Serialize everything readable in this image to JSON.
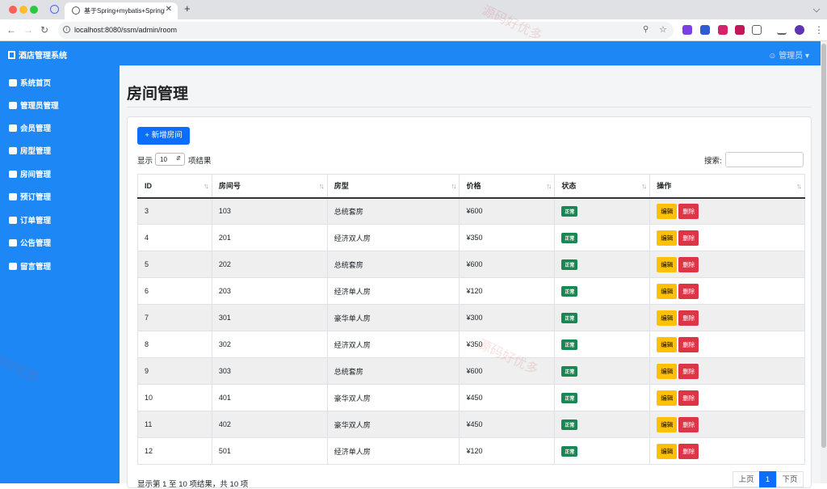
{
  "browser": {
    "tab_title": "基于Spring+mybatis+SpringM",
    "tab_close": "✕",
    "new_tab": "+",
    "url": "localhost:8080/ssm/admin/room"
  },
  "app": {
    "brand": "酒店管理系统",
    "user_menu": "管理员",
    "accent": "#1d87f5"
  },
  "sidebar": {
    "items": [
      {
        "label": "系统首页",
        "icon": "dashboard-icon"
      },
      {
        "label": "管理员管理",
        "icon": "user-cog-icon"
      },
      {
        "label": "会员管理",
        "icon": "users-icon"
      },
      {
        "label": "房型管理",
        "icon": "grid-icon"
      },
      {
        "label": "房间管理",
        "icon": "door-icon"
      },
      {
        "label": "预订管理",
        "icon": "calendar-icon"
      },
      {
        "label": "订单管理",
        "icon": "file-icon"
      },
      {
        "label": "公告管理",
        "icon": "bullhorn-icon"
      },
      {
        "label": "留言管理",
        "icon": "comments-icon"
      }
    ]
  },
  "page": {
    "title": "房间管理",
    "add_button": "新增房间",
    "length_prefix": "显示",
    "length_value": "10",
    "length_suffix": "项结果",
    "search_label": "搜索:"
  },
  "table": {
    "columns": [
      "ID",
      "房间号",
      "房型",
      "价格",
      "状态",
      "操作"
    ],
    "rows": [
      {
        "id": "3",
        "number": "103",
        "type": "总统套房",
        "price": "¥600",
        "status": "正常"
      },
      {
        "id": "4",
        "number": "201",
        "type": "经济双人房",
        "price": "¥350",
        "status": "正常"
      },
      {
        "id": "5",
        "number": "202",
        "type": "总统套房",
        "price": "¥600",
        "status": "正常"
      },
      {
        "id": "6",
        "number": "203",
        "type": "经济单人房",
        "price": "¥120",
        "status": "正常"
      },
      {
        "id": "7",
        "number": "301",
        "type": "豪华单人房",
        "price": "¥300",
        "status": "正常"
      },
      {
        "id": "8",
        "number": "302",
        "type": "经济双人房",
        "price": "¥350",
        "status": "正常"
      },
      {
        "id": "9",
        "number": "303",
        "type": "总统套房",
        "price": "¥600",
        "status": "正常"
      },
      {
        "id": "10",
        "number": "401",
        "type": "豪华双人房",
        "price": "¥450",
        "status": "正常"
      },
      {
        "id": "11",
        "number": "402",
        "type": "豪华双人房",
        "price": "¥450",
        "status": "正常"
      },
      {
        "id": "12",
        "number": "501",
        "type": "经济单人房",
        "price": "¥120",
        "status": "正常"
      }
    ],
    "edit_label": "编辑",
    "delete_label": "删除"
  },
  "footer": {
    "info": "显示第 1 至 10 项结果，共 10 项",
    "prev": "上页",
    "page": "1",
    "next": "下页"
  },
  "watermark": "源码好优多"
}
